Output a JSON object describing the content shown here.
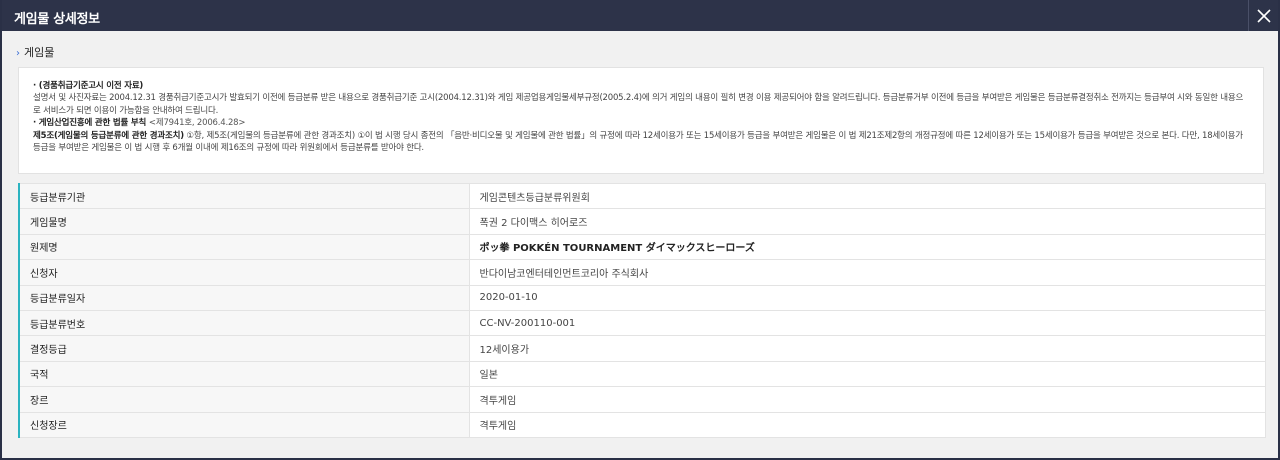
{
  "window": {
    "title": "게임물 상세정보",
    "close_icon": "close-icon"
  },
  "section": {
    "label": "게임물",
    "chevron_icon": "chevron-right-icon"
  },
  "notice": {
    "p1_head": "· (경품취급기준고시 이전 자료)",
    "p1_body": "설명서 및 사진자료는 2004.12.31 경품취급기준고시가 발효되기 이전에 등급분류 받은 내용으로 경품취급기준 고시(2004.12.31)와 게임 제공업용게임물세부규정(2005.2.4)에 의거 게임의 내용이 필히 변경 이용 제공되어야 함을 알려드립니다. 등급분류거부 이전에 등급을 부여받은 게임물은 등급분류결정취소 전까지는 등급부여 시와 동일한 내용으로 서비스가 되면 이용이 가능함을 안내하여 드립니다.",
    "p2_head": "· 게임산업진흥에 관한 법률 부칙",
    "p2_sub": "<제7941호, 2006.4.28>",
    "p2_bold": "제5조(게임물의 등급분류에 관한 경과조치)",
    "p2_body": " ①항, 제5조(게임물의 등급분류에 관한 경과조치) ①이 법 시행 당시 종전의 「음반·비디오물 및 게임물에 관한 법률」의 규정에 따라 12세이용가 또는 15세이용가 등급을 부여받은 게임물은 이 법 제21조제2항의 개정규정에 따른 12세이용가 또는 15세이용가 등급을 부여받은 것으로 본다. 다만, 18세이용가 등급을 부여받은 게임물은 이 법 시행 후 6개월 이내에 제16조의 규정에 따라 위원회에서 등급분류를 받아야 한다."
  },
  "details": {
    "rows": [
      {
        "label": "등급분류기관",
        "value": "게임콘텐츠등급분류위원회"
      },
      {
        "label": "게임물명",
        "value": "폭권 2 다이맥스 히어로즈"
      },
      {
        "label": "원제명",
        "value": "ポッ拳 POKKÉN TOURNAMENT ダイマックスヒーローズ"
      },
      {
        "label": "신청자",
        "value": "반다이남코엔터테인먼트코리아 주식회사"
      },
      {
        "label": "등급분류일자",
        "value": "2020-01-10"
      },
      {
        "label": "등급분류번호",
        "value": "CC-NV-200110-001"
      },
      {
        "label": "결정등급",
        "value": "12세이용가"
      },
      {
        "label": "국적",
        "value": "일본"
      },
      {
        "label": "장르",
        "value": "격투게임"
      },
      {
        "label": "신청장르",
        "value": "격투게임"
      }
    ]
  },
  "colors": {
    "titlebar": "#2d3349",
    "accent_border": "#2bb3c0",
    "chevron": "#3b6fd6"
  }
}
